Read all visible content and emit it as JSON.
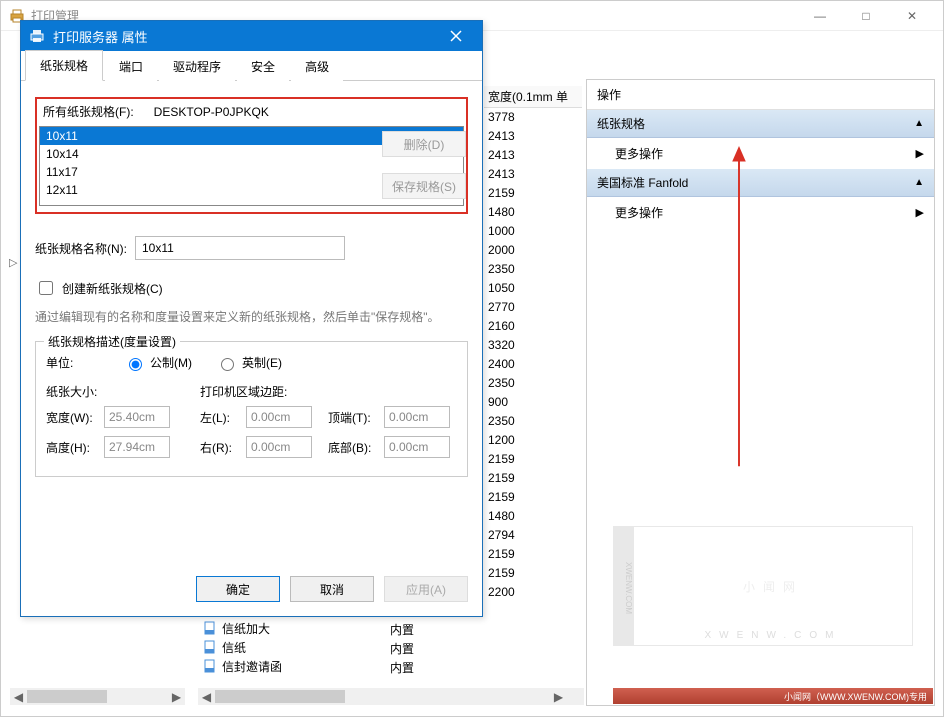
{
  "main_window": {
    "title": "打印管理",
    "controls": {
      "min": "—",
      "max": "□",
      "close": "✕"
    }
  },
  "width_column": {
    "header": "宽度(0.1mm 单",
    "values": [
      "3778",
      "2413",
      "2413",
      "2413",
      "2159",
      "1480",
      "1000",
      "2000",
      "2350",
      "1050",
      "2770",
      "2160",
      "3320",
      "2400",
      "2350",
      "900",
      "2350",
      "1200",
      "2159",
      "2159",
      "2159",
      "1480",
      "2794",
      "2159",
      "2159",
      "2200"
    ]
  },
  "bg_rows": [
    {
      "name": "信纸加大",
      "type": "内置"
    },
    {
      "name": "信纸",
      "type": "内置"
    },
    {
      "name": "信封邀请函",
      "type": "内置"
    }
  ],
  "actions_pane": {
    "header": "操作",
    "section1": "纸张规格",
    "item1": "更多操作",
    "section2": "美国标准 Fanfold",
    "item2": "更多操作"
  },
  "dialog": {
    "title": "打印服务器 属性",
    "tabs": [
      "纸张规格",
      "端口",
      "驱动程序",
      "安全",
      "高级"
    ],
    "formats_label": "所有纸张规格(F):",
    "server_name": "DESKTOP-P0JPKQK",
    "formats": [
      "10x11",
      "10x14",
      "11x17",
      "12x11"
    ],
    "delete_btn": "删除(D)",
    "save_btn": "保存规格(S)",
    "name_label": "纸张规格名称(N):",
    "name_value": "10x11",
    "create_new": "创建新纸张规格(C)",
    "help_text": "通过编辑现有的名称和度量设置来定义新的纸张规格，然后单击\"保存规格\"。",
    "fieldset_legend": "纸张规格描述(度量设置)",
    "unit_label": "单位:",
    "unit_metric": "公制(M)",
    "unit_english": "英制(E)",
    "paper_size_label": "纸张大小:",
    "margins_label": "打印机区域边距:",
    "width_label": "宽度(W):",
    "width_value": "25.40cm",
    "left_label": "左(L):",
    "left_value": "0.00cm",
    "top_label": "顶端(T):",
    "top_value": "0.00cm",
    "height_label": "高度(H):",
    "height_value": "27.94cm",
    "right_label": "右(R):",
    "right_value": "0.00cm",
    "bottom_label": "底部(B):",
    "bottom_value": "0.00cm",
    "ok_btn": "确定",
    "cancel_btn": "取消",
    "apply_btn": "应用(A)"
  },
  "watermark": {
    "text": "小闻网",
    "sub": "XWENW.COM",
    "side": "XWENW.COM",
    "footer": "小闻网（WWW.XWENW.COM)专用"
  }
}
